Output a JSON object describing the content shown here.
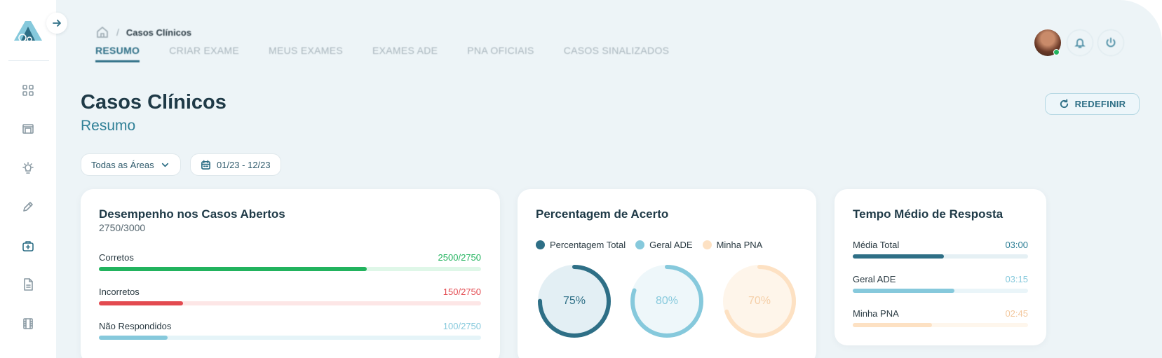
{
  "breadcrumb": {
    "current": "Casos Clínicos",
    "home_icon": "home-icon"
  },
  "tabs": [
    {
      "label": "RESUMO",
      "active": true
    },
    {
      "label": "CRIAR EXAME",
      "active": false
    },
    {
      "label": "MEUS EXAMES",
      "active": false
    },
    {
      "label": "EXAMES ADE",
      "active": false
    },
    {
      "label": "PNA OFICIAIS",
      "active": false
    },
    {
      "label": "CASOS SINALIZADOS",
      "active": false
    }
  ],
  "header": {
    "title": "Casos Clínicos",
    "subtitle": "Resumo",
    "reset_label": "REDEFINIR"
  },
  "filters": {
    "area": "Todas as Áreas",
    "date_range": "01/23 - 12/23"
  },
  "performance": {
    "title": "Desempenho nos Casos Abertos",
    "summary": "2750/3000",
    "rows": [
      {
        "label": "Corretos",
        "value": "2500/2750",
        "fraction": 0.7,
        "color": "#22b35e",
        "track": "#dff7e8"
      },
      {
        "label": "Incorretos",
        "value": "150/2750",
        "fraction": 0.22,
        "color": "#e34a50",
        "track": "#fde6e6"
      },
      {
        "label": "Não Respondidos",
        "value": "100/2750",
        "fraction": 0.18,
        "color": "#86c9dc",
        "track": "#e5f4f8"
      }
    ]
  },
  "accuracy": {
    "title": "Percentagem de Acerto",
    "items": [
      {
        "legend": "Percentagem Total",
        "value": "75%",
        "percent": 75,
        "color": "#2e6f86",
        "bg": "#e3eff4",
        "text": "#2e6f86"
      },
      {
        "legend": "Geral ADE",
        "value": "80%",
        "percent": 80,
        "color": "#86c9dc",
        "bg": "#eef7fa",
        "text": "#86c9dc"
      },
      {
        "legend": "Minha PNA",
        "value": "70%",
        "percent": 70,
        "color": "#fde1c3",
        "bg": "#fef5ea",
        "text": "#f5cfa8"
      }
    ]
  },
  "response_time": {
    "title": "Tempo Médio de Resposta",
    "rows": [
      {
        "label": "Média Total",
        "value": "03:00",
        "fraction": 0.52,
        "color": "#2e6f86",
        "track": "#e5f0f4",
        "text": "#2e7f96"
      },
      {
        "label": "Geral ADE",
        "value": "03:15",
        "fraction": 0.58,
        "color": "#86c9dc",
        "track": "#eaf5f9",
        "text": "#86c9dc"
      },
      {
        "label": "Minha PNA",
        "value": "02:45",
        "fraction": 0.45,
        "color": "#fde1c3",
        "track": "#fef6ec",
        "text": "#f3c89e"
      }
    ]
  },
  "sidebar": {
    "icons": [
      "dashboard-icon",
      "library-icon",
      "lightbulb-icon",
      "pencil-icon",
      "medical-kit-icon",
      "document-icon",
      "film-icon"
    ],
    "active_index": 4
  }
}
